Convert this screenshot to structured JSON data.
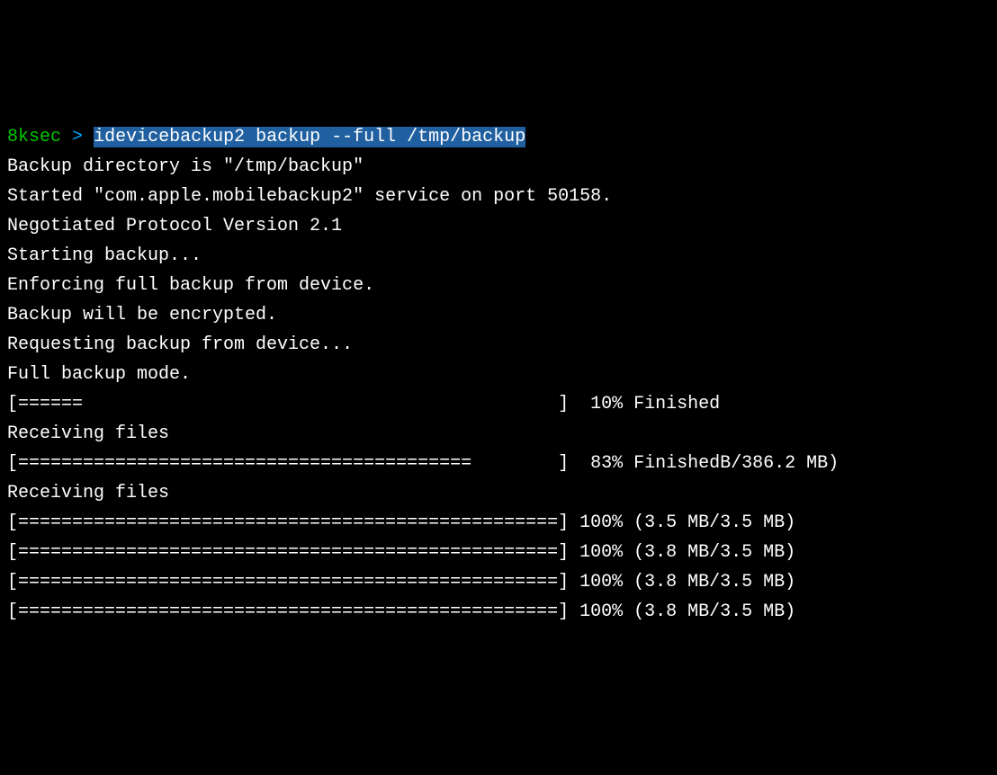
{
  "prompt": {
    "user": "8ksec",
    "arrow": ">",
    "command": "idevicebackup2 backup --full /tmp/backup"
  },
  "lines": {
    "l1": "Backup directory is \"/tmp/backup\"",
    "l2": "Started \"com.apple.mobilebackup2\" service on port 50158.",
    "l3": "Negotiated Protocol Version 2.1",
    "l4": "Starting backup...",
    "l5": "Enforcing full backup from device.",
    "l6": "Backup will be encrypted.",
    "l7": "Requesting backup from device...",
    "l8": "Full backup mode.",
    "l9": "[======                                            ]  10% Finished",
    "l10": "Receiving files",
    "l11": "[==========================================        ]  83% FinishedB/386.2 MB)",
    "l12": "Receiving files",
    "l13": "[==================================================] 100% (3.5 MB/3.5 MB)",
    "l14": "[==================================================] 100% (3.8 MB/3.5 MB)",
    "l15": "[==================================================] 100% (3.8 MB/3.5 MB)",
    "l16": "[==================================================] 100% (3.8 MB/3.5 MB)"
  }
}
